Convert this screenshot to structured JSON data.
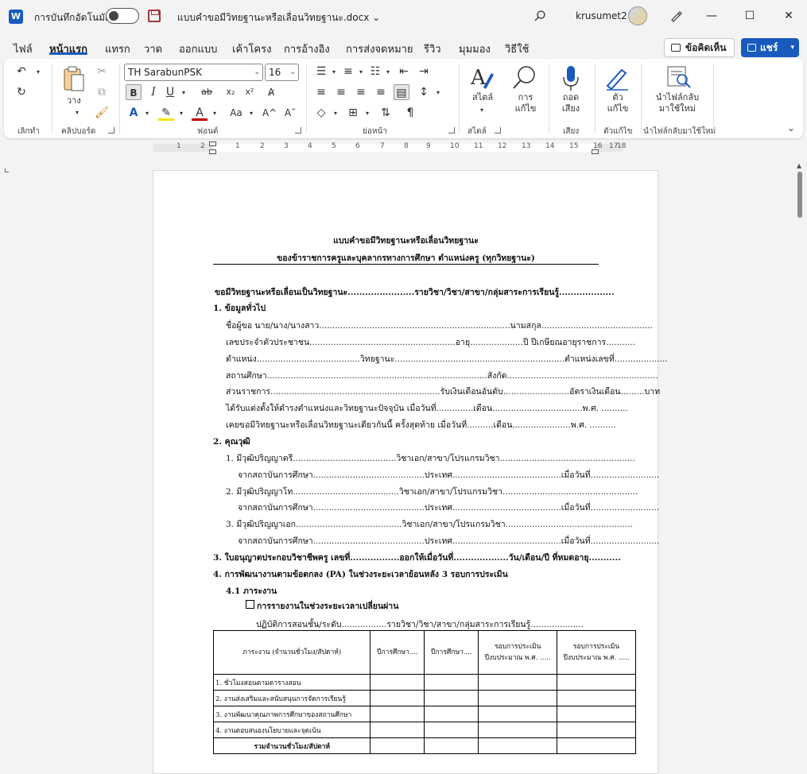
{
  "titlebar": {
    "app_icon": "W",
    "autosave_label": "การบันทึกอัตโนมัติ",
    "doc_title": "แบบคำขอมีวิทยฐานะหรือเลื่อนวิทยฐานะ.docx",
    "username": "krusumet2",
    "minimize": "—",
    "maximize": "☐",
    "close": "✕"
  },
  "tabs": [
    "ไฟล์",
    "หน้าแรก",
    "แทรก",
    "วาด",
    "ออกแบบ",
    "เค้าโครง",
    "การอ้างอิง",
    "การส่งจดหมาย",
    "รีวิว",
    "มุมมอง",
    "วิธีใช้"
  ],
  "comments_label": "ข้อคิดเห็น",
  "share_label": "แชร์",
  "ribbon": {
    "undo_group": "เลิกทำ",
    "clipboard_group": "คลิปบอร์ด",
    "paste_label": "วาง",
    "font_group": "ฟอนต์",
    "font_name": "TH SarabunPSK",
    "font_size": "16",
    "paragraph_group": "ย่อหน้า",
    "styles_group": "สไตล์",
    "styles_label": "สไตล์",
    "editing_label": "การ แก้ไข",
    "voice_group": "เสียง",
    "dictate_label": "ถอด เสียง",
    "editor_group": "ตัวแก้ไข",
    "editor_label": "ตัว แก้ไข",
    "reuse_group": "นำไฟล์กลับมาใช้ใหม่",
    "reuse_label": "นำไฟล์กลับ มาใช้ใหม่"
  },
  "ruler_numbers": [
    "1",
    "2",
    "1",
    "2",
    "3",
    "4",
    "5",
    "6",
    "7",
    "8",
    "9",
    "10",
    "11",
    "12",
    "13",
    "14",
    "15",
    "16",
    "17",
    "18"
  ],
  "document": {
    "title1": "แบบคำขอมีวิทยฐานะหรือเลื่อนวิทยฐานะ",
    "title2": "ของข้าราชการครูและบุคลากรทางการศึกษา ตำแหน่งครู (ทุกวิทยฐานะ)",
    "request_line": "ขอมีวิทยฐานะหรือเลื่อนเป็นวิทยฐานะ.......................รายวิชา/วิชา/สาขา/กลุ่มสาระการเรียนรู้...................",
    "s1": "1. ข้อมูลทั่วไป",
    "s1_l1": "ชื่อผู้ขอ นาย/นาง/นางสาว........................................................................นามสกุล..........................................",
    "s1_l2": "เลขประจำตัวประชาชน.......................................................อายุ....................ปี ปีเกษียณอายุราชการ...........",
    "s1_l3": "ตำแหน่ง.......................................วิทยฐานะ................................................................ตำแหน่งเลขที่....................",
    "s1_l4": "สถานศึกษา...................................................................................สังกัด.........................................................",
    "s1_l5": "ส่วนราชการ................................................................รับเงินเดือนอันดับ.........................อัตราเงินเดือน.........บาท",
    "s1_l6": "ได้รับแต่งตั้งให้ดำรงตำแหน่งและวิทยฐานะปัจจุบัน เมื่อวันที่..............เดือน..................................พ.ศ. ..........",
    "s1_l7": "เคยขอมีวิทยฐานะหรือเลื่อนวิทยฐานะเดียวกันนี้ ครั้งสุดท้าย เมื่อวันที่..........เดือน......................พ.ศ. ..........",
    "s2": "2. คุณวุฒิ",
    "s2_l1": "1. มีวุฒิปริญญาตรี.......................................วิชาเอก/สาขา/โปรแกรมวิชา...................................................",
    "s2_l2": "จากสถาบันการศึกษา..........................................ประเทศ.........................................เมื่อวันที่..........................",
    "s2_l3": "2. มีวุฒิปริญญาโท........................................วิชาเอก/สาขา/โปรแกรมวิชา...................................................",
    "s2_l4": "จากสถาบันการศึกษา..........................................ประเทศ.........................................เมื่อวันที่..........................",
    "s2_l5": "3. มีวุฒิปริญญาเอก........................................วิชาเอก/สาขา/โปรแกรมวิชา................................................",
    "s2_l6": "จากสถาบันการศึกษา..........................................ประเทศ.........................................เมื่อวันที่..........................",
    "s3": "3. ใบอนุญาตประกอบวิชาชีพครู เลขที่.................ออกให้เมื่อวันที่...................วัน/เดือน/ปี ที่หมดอายุ...........",
    "s4": "4. การพัฒนางานตามข้อตกลง (PA) ในช่วงระยะเวลาย้อนหลัง 3 รอบการประเมิน",
    "s41": "4.1 ภาระงาน",
    "transition": "การรายงานในช่วงระยะเวลาเปลี่ยนผ่าน",
    "practice_line": "ปฏิบัติการสอนชั้น/ระดับ.................รายวิชา/วิชา/สาขา/กลุ่มสาระการเรียนรู้....................",
    "table": {
      "headers": [
        "ภาระงาน (จำนวนชั่วโมง/สัปดาห์)",
        "ปีการศึกษา....",
        "ปีการศึกษา....",
        "รอบการประเมิน ปีงบประมาณ พ.ศ. .....",
        "รอบการประเมิน ปีงบประมาณ พ.ศ. ....."
      ],
      "rows": [
        "1. ชั่วโมงสอนตามตารางสอน",
        "2. งานส่งเสริมและสนับสนุนการจัดการเรียนรู้",
        "3. งานพัฒนาคุณภาพการศึกษาของสถานศึกษา",
        "4. งานตอบสนองนโยบายและจุดเน้น"
      ],
      "total": "รวมจำนวนชั่วโมง/สัปดาห์"
    }
  }
}
